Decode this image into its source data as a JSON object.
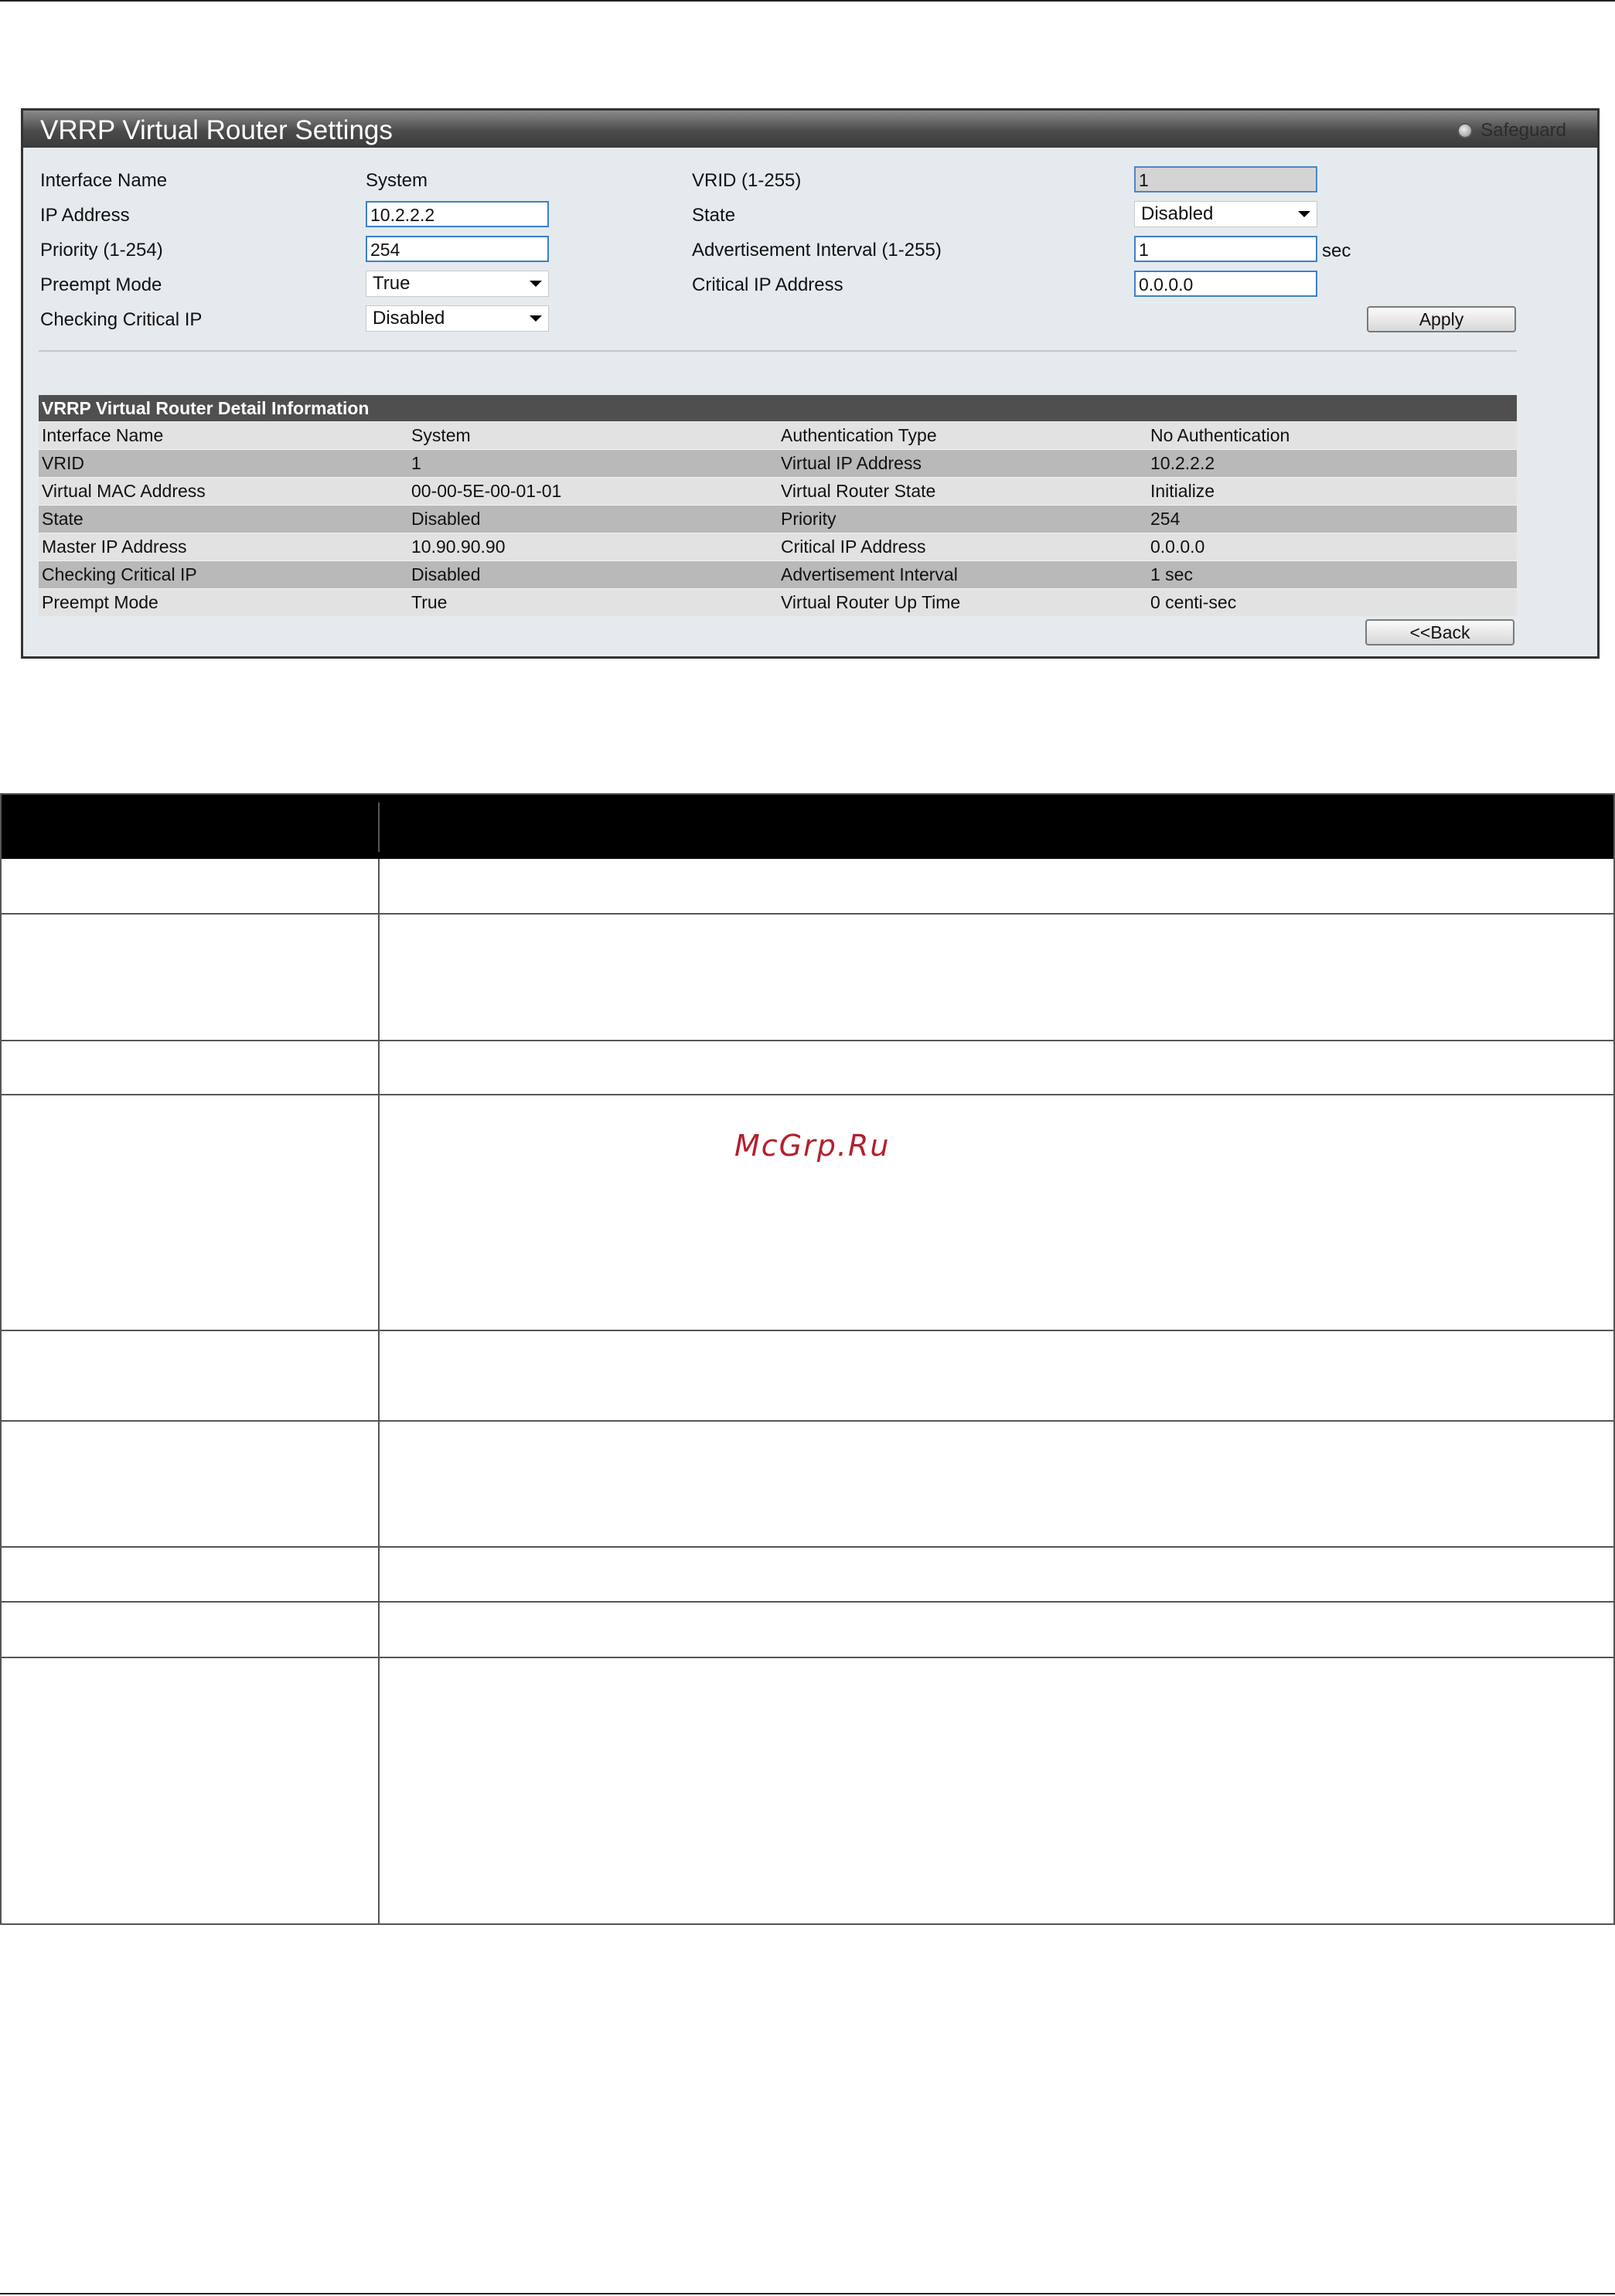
{
  "panel": {
    "title": "VRRP Virtual Router Settings",
    "safeguard_label": "Safeguard"
  },
  "form": {
    "interface_name_label": "Interface Name",
    "interface_name_value": "System",
    "ip_address_label": "IP Address",
    "ip_address_value": "10.2.2.2",
    "priority_label": "Priority (1-254)",
    "priority_value": "254",
    "preempt_mode_label": "Preempt Mode",
    "preempt_mode_value": "True",
    "checking_critical_ip_label": "Checking Critical IP",
    "checking_critical_ip_value": "Disabled",
    "vrid_label": "VRID (1-255)",
    "vrid_value": "1",
    "state_label": "State",
    "state_value": "Disabled",
    "adv_interval_label": "Advertisement Interval (1-255)",
    "adv_interval_value": "1",
    "adv_interval_unit": "sec",
    "critical_ip_label": "Critical IP Address",
    "critical_ip_value": "0.0.0.0",
    "apply_label": "Apply"
  },
  "detail": {
    "title": "VRRP Virtual Router Detail Information",
    "rows": [
      [
        "Interface Name",
        "System",
        "Authentication Type",
        "No Authentication"
      ],
      [
        "VRID",
        "1",
        "Virtual IP Address",
        "10.2.2.2"
      ],
      [
        "Virtual MAC Address",
        "00-00-5E-00-01-01",
        "Virtual Router State",
        "Initialize"
      ],
      [
        "State",
        "Disabled",
        "Priority",
        "254"
      ],
      [
        "Master IP Address",
        "10.90.90.90",
        "Critical IP Address",
        "0.0.0.0"
      ],
      [
        "Checking Critical IP",
        "Disabled",
        "Advertisement Interval",
        "1 sec"
      ],
      [
        "Preempt Mode",
        "True",
        "Virtual Router Up Time",
        "0 centi-sec"
      ]
    ],
    "back_label": "<<Back"
  },
  "watermark": "McGrp.Ru",
  "icons": {
    "safeguard": "safeguard-status-icon",
    "dropdown": "chevron-down-icon"
  },
  "colors": {
    "panel_bg": "#e5eaee",
    "input_border": "#3f7fc8",
    "detail_header": "#4f4f4f",
    "watermark": "#b3202c"
  }
}
